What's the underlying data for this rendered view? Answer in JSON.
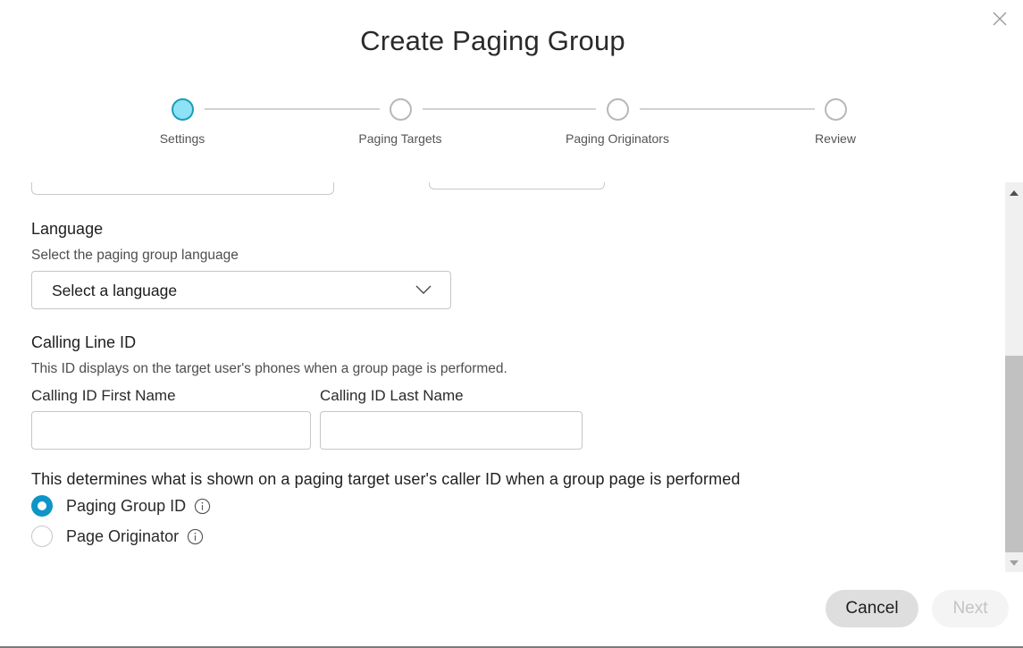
{
  "dialog": {
    "title": "Create Paging Group",
    "close_icon": "close-icon"
  },
  "stepper": {
    "steps": [
      {
        "label": "Settings",
        "state": "active"
      },
      {
        "label": "Paging Targets",
        "state": "pending"
      },
      {
        "label": "Paging Originators",
        "state": "pending"
      },
      {
        "label": "Review",
        "state": "pending"
      }
    ],
    "active_color": "#8ee2f5"
  },
  "language": {
    "title": "Language",
    "help": "Select the paging group language",
    "select_value": "Select a language",
    "chevron_icon": "chevron-down-icon"
  },
  "calling_line_id": {
    "title": "Calling Line ID",
    "help": "This ID displays on the target user's phones when a group page is performed.",
    "first_name_label": "Calling ID First Name",
    "first_name_value": "",
    "last_name_label": "Calling ID Last Name",
    "last_name_value": ""
  },
  "caller_id_display": {
    "description": "This determines what is shown on a paging target user's caller ID when a group page is performed",
    "options": [
      {
        "label": "Paging Group ID",
        "checked": true,
        "info_icon": "info-icon"
      },
      {
        "label": "Page Originator",
        "checked": false,
        "info_icon": "info-icon"
      }
    ],
    "accent_color": "#0d95c8"
  },
  "footer": {
    "cancel_label": "Cancel",
    "next_label": "Next",
    "next_disabled": true
  }
}
